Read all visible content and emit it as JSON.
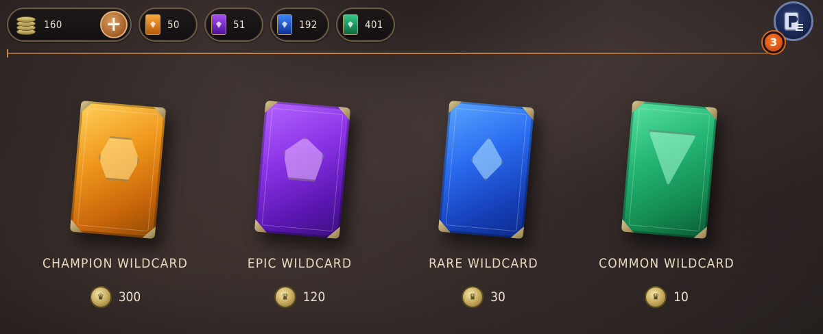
{
  "currency_bar": {
    "coins": {
      "value": "160",
      "icon": "coin-stack-icon",
      "add_label": "+"
    },
    "shards": [
      {
        "name": "champion-shard",
        "value": "50",
        "color": "#f08a1a"
      },
      {
        "name": "epic-shard",
        "value": "51",
        "color": "#8a2ad8"
      },
      {
        "name": "rare-shard",
        "value": "192",
        "color": "#2060d8"
      },
      {
        "name": "common-shard",
        "value": "401",
        "color": "#1c9a62"
      }
    ]
  },
  "profile": {
    "icon": "player-profile-icon",
    "notification_count": "3"
  },
  "shop_items": [
    {
      "id": "champion",
      "label": "CHAMPION WILDCARD",
      "price": "300",
      "color": "#e08a12",
      "color_dark": "#8e4a05",
      "icon": "hexagon-gem-icon"
    },
    {
      "id": "epic",
      "label": "EPIC WILDCARD",
      "price": "120",
      "color": "#7b2bd6",
      "color_dark": "#3b0f7a",
      "icon": "pentagon-gem-icon"
    },
    {
      "id": "rare",
      "label": "RARE WILDCARD",
      "price": "30",
      "color": "#1e5fe0",
      "color_dark": "#0b2a88",
      "icon": "diamond-gem-icon"
    },
    {
      "id": "common",
      "label": "COMMON WILDCARD",
      "price": "10",
      "color": "#1fae6d",
      "color_dark": "#0b5a36",
      "icon": "triangle-gem-icon"
    }
  ]
}
